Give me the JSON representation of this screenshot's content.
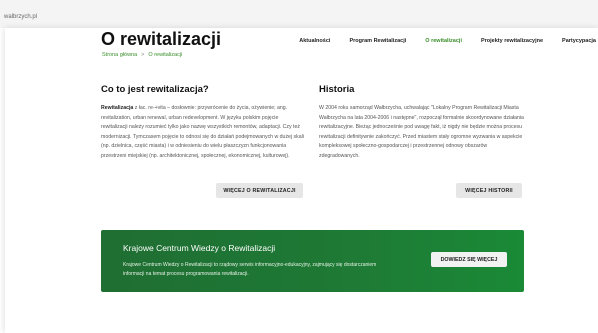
{
  "browser": {
    "url": "walbrzych.pl"
  },
  "nav": {
    "items": [
      "Aktualności",
      "Program Rewitalizacji",
      "O rewitalizacji",
      "Projekty rewitalizacyjne",
      "Partycypacja"
    ],
    "active": "O rewitalizacji"
  },
  "page": {
    "title": "O rewitalizacji",
    "breadcrumb": [
      "Strona główna",
      "O rewitalizacji"
    ],
    "breadcrumb_separator": ">"
  },
  "left_section": {
    "heading": "Co to jest rewitalizacja?",
    "lead": "Rewitalizacja",
    "body": " z łac. re-+vita – dosłownie: przywrócenie do życia, ożywienie; ang. revitalization, urban renewal, urban redevelopment. W języku polskim pojęcie rewitalizacji należy rozumieć tylko jako nazwę wszystkich remontów, adaptacji. Czy też modernizacji. Tymczasem pojęcie to odnosi się do działań podejmowanych w dużej skali (np. dzielnica, część miasta) i w odniesieniu do wielu płaszczyzn funkcjonowania przestrzeni miejskiej (np. architektonicznej, społecznej, ekonomicznej, kulturowej).",
    "button": "WIĘCEJ O REWITALIZACJI"
  },
  "right_section": {
    "heading": "Historia",
    "body": "W 2004 roku samorząd Wałbrzycha, uchwalając \"Lokalny Program Rewitalizacji Miasta Wałbrzycha na lata 2004-2006 i następne\", rozpoczął formalnie skoordynowane działania rewitalizacyjne. Bieżąc jednocześnie pod uwagę fakt, iż nigdy nie będzie można procesu rewitalizacji definitywnie zakończyć. Przed miastem stały ogromne wyzwania w aspekcie kompleksowej społeczno-gospodarczej i przestrzennej odnowy obszarów zdegradowanych.",
    "button": "WIĘCEJ HISTORII"
  },
  "banner": {
    "title": "Krajowe Centrum Wiedzy o Rewitalizacji",
    "text": "Krajowe Centrum Wiedzy o Rewitalizacji to rządowy serwis informacyjno-edukacyjny, zajmujący się dostarczaniem informacji na temat procesu programowania rewitalizacji.",
    "button": "DOWIEDZ SIĘ WIĘCEJ",
    "color": "#1e7a35"
  },
  "colors": {
    "accent": "#3a8f2a"
  }
}
